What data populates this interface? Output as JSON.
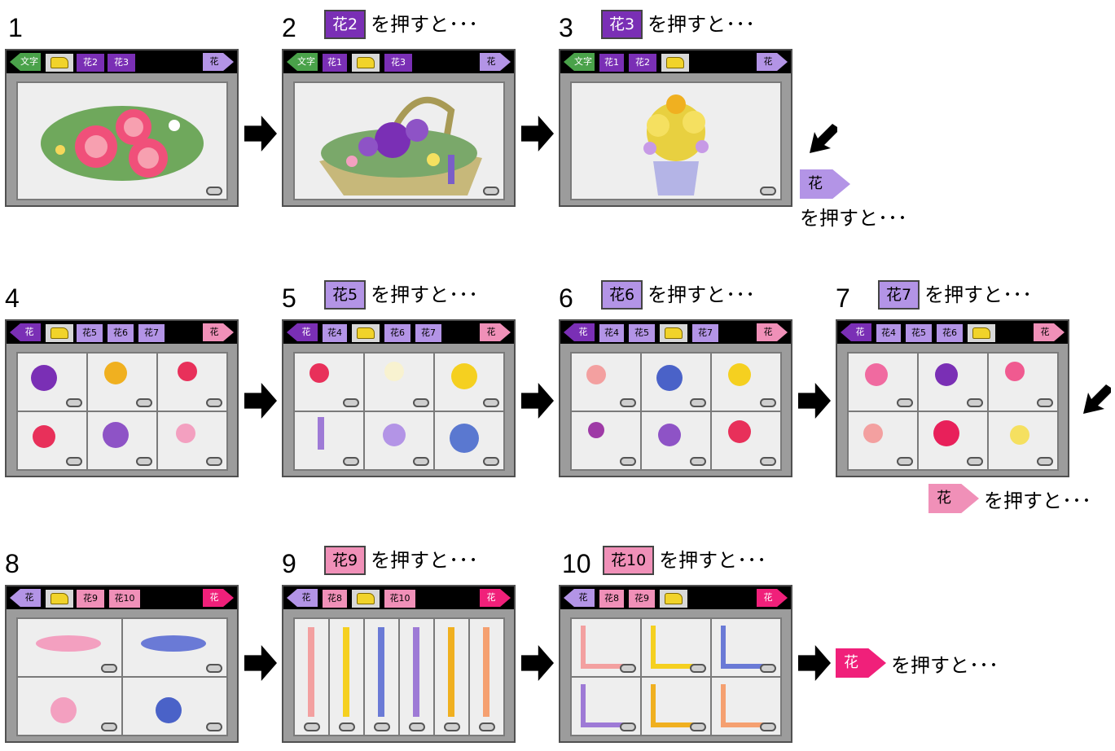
{
  "suffix": "を押すと･･･",
  "colors": {
    "dark": "#7a2fb5",
    "lavender": "#b394e6",
    "pink": "#f090b8",
    "magenta": "#f0207a",
    "green": "#4aa24a"
  },
  "steps": [
    {
      "num": "1",
      "caption_button": "",
      "left_arrow": "文字",
      "tabs": [
        "folder",
        "花2",
        "花3"
      ],
      "right_arrow": "花"
    },
    {
      "num": "2",
      "caption_button": "花2",
      "left_arrow": "文字",
      "tabs": [
        "花1",
        "folder",
        "花3"
      ],
      "right_arrow": "花"
    },
    {
      "num": "3",
      "caption_button": "花3",
      "left_arrow": "文字",
      "tabs": [
        "花1",
        "花2",
        "folder"
      ],
      "right_arrow": "花"
    },
    {
      "num": "4",
      "caption_button": "",
      "left_arrow": "花",
      "tabs": [
        "folder",
        "花5",
        "花6",
        "花7"
      ],
      "right_arrow": "花"
    },
    {
      "num": "5",
      "caption_button": "花5",
      "left_arrow": "花",
      "tabs": [
        "花4",
        "folder",
        "花6",
        "花7"
      ],
      "right_arrow": "花"
    },
    {
      "num": "6",
      "caption_button": "花6",
      "left_arrow": "花",
      "tabs": [
        "花4",
        "花5",
        "folder",
        "花7"
      ],
      "right_arrow": "花"
    },
    {
      "num": "7",
      "caption_button": "花7",
      "left_arrow": "花",
      "tabs": [
        "花4",
        "花5",
        "花6",
        "folder"
      ],
      "right_arrow": "花"
    },
    {
      "num": "8",
      "caption_button": "",
      "left_arrow": "花",
      "tabs": [
        "folder",
        "花9",
        "花10"
      ],
      "right_arrow": "花"
    },
    {
      "num": "9",
      "caption_button": "花9",
      "left_arrow": "花",
      "tabs": [
        "花8",
        "folder",
        "花10"
      ],
      "right_arrow": "花"
    },
    {
      "num": "10",
      "caption_button": "花10",
      "left_arrow": "花",
      "tabs": [
        "花8",
        "花9",
        "folder"
      ],
      "right_arrow": "花"
    }
  ],
  "hints": {
    "row1": "花",
    "row2": "花",
    "row3": "花"
  }
}
